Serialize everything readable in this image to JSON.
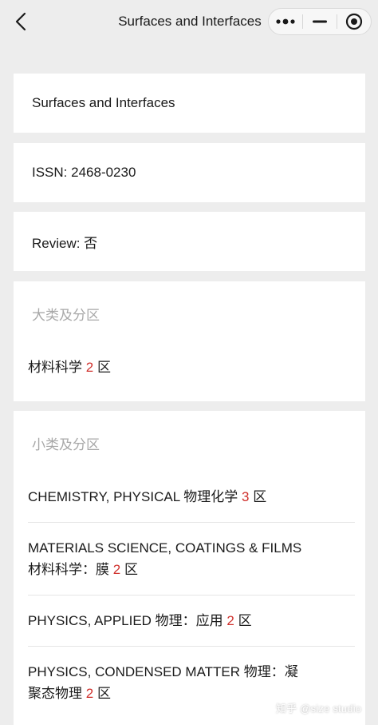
{
  "header": {
    "title": "Surfaces and Interfaces",
    "back_icon": "chevron-left-icon",
    "capsule_icons": [
      "more-dots-icon",
      "minimize-icon",
      "close-target-icon"
    ]
  },
  "journal": {
    "name": "Surfaces and Interfaces",
    "issn": "ISSN: 2468-0230",
    "review": "Review: 否"
  },
  "major_category": {
    "section_label": "大类及分区",
    "subject": "材料科学",
    "zone_number": "2",
    "zone_suffix": "区"
  },
  "minor_category": {
    "section_label": "小类及分区",
    "items": [
      {
        "line1": "CHEMISTRY, PHYSICAL 物理化学",
        "line2": "",
        "zone_number": "3",
        "zone_suffix": "区"
      },
      {
        "line1": "MATERIALS SCIENCE, COATINGS & FILMS",
        "line2": "材料科学：膜",
        "zone_number": "2",
        "zone_suffix": "区"
      },
      {
        "line1": "PHYSICS, APPLIED 物理：应用",
        "line2": "",
        "zone_number": "2",
        "zone_suffix": "区"
      },
      {
        "line1": "PHYSICS, CONDENSED MATTER 物理：凝",
        "line2": "聚态物理",
        "zone_number": "2",
        "zone_suffix": "区"
      }
    ]
  },
  "watermark": "知乎 @size studio",
  "colors": {
    "background": "#ededed",
    "card": "#ffffff",
    "zone_red": "#d0312d",
    "label_gray": "#a8a8a8"
  }
}
